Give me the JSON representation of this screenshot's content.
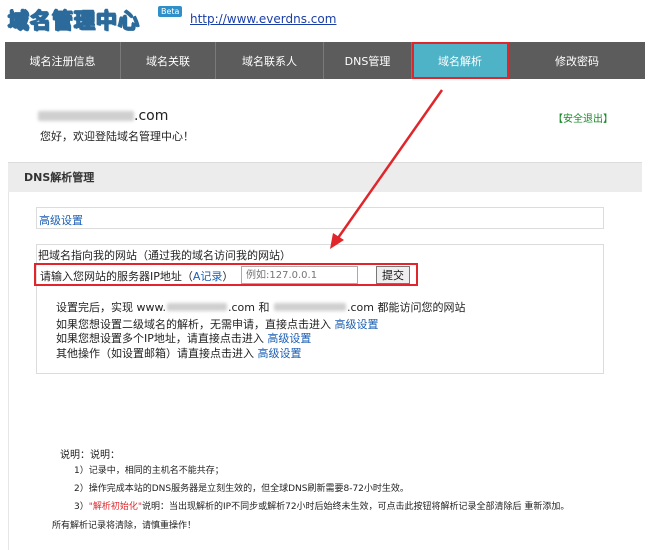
{
  "header": {
    "logo_text": "域名管理中心",
    "beta_badge": "Beta",
    "site_url": "http://www.everdns.com"
  },
  "nav": {
    "tabs": [
      {
        "label": "域名注册信息"
      },
      {
        "label": "域名关联"
      },
      {
        "label": "域名联系人"
      },
      {
        "label": "DNS管理"
      },
      {
        "label": "域名解析",
        "active": true
      },
      {
        "label": "修改密码"
      }
    ]
  },
  "welcome": {
    "domain_suffix": ".com",
    "message": "您好，欢迎登陆域名管理中心！",
    "logout": "【安全退出】"
  },
  "section": {
    "title": "DNS解析管理",
    "advanced_link": "高级设置",
    "point_title": "把域名指向我的网站（通过我的域名访问我的网站）",
    "ip_label": "请输入您网站的服务器IP地址（",
    "a_record": "A记录",
    "ip_label_close": "）",
    "ip_placeholder": "例如:127.0.0.1",
    "submit": "提交"
  },
  "info": {
    "line1_prefix": "设置完后，实现 www.",
    "line1_mid": ".com 和",
    "line1_suffix": ".com 都能访问您的网站",
    "line2_text": "如果您想设置二级域名的解析，无需申请，直接点击进入",
    "line3_text": "如果您想设置多个IP地址，请直接点击进入",
    "line4_text": "其他操作（如设置邮箱）请直接点击进入",
    "link_label": "高级设置"
  },
  "notes": {
    "title": "说明：说明：",
    "n1": "1）记录中，相同的主机名不能共存；",
    "n2": "2）操作完成本站的DNS服务器是立刻生效的，但全球DNS刷新需要8-72小时生效。",
    "n3_prefix": "3）",
    "n3_red": "\"解析初始化\"",
    "n3_rest": "说明：当出现解析的IP不同步或解析72小时后始终未生效，可点击此按钮将解析记录全部清除后 重新添加。",
    "n4": "所有解析记录将清除，请慎重操作！"
  },
  "colors": {
    "nav_bg": "#5c5c5c",
    "active_tab": "#4fb3c7",
    "highlight": "#e0262b",
    "link": "#1a5fb4",
    "logout": "#1a8a2a"
  }
}
